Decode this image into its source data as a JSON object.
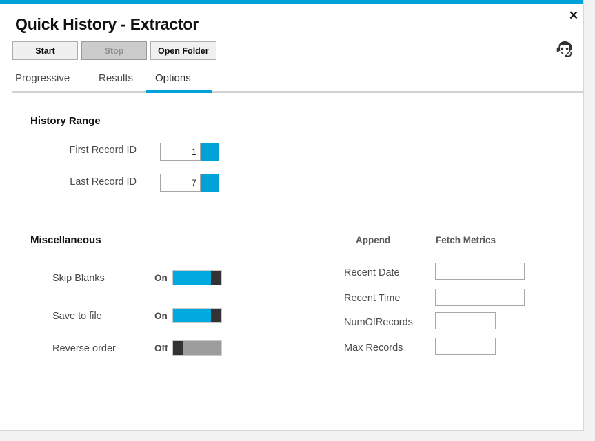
{
  "window": {
    "title": "Quick History - Extractor",
    "close_label": "✕",
    "accent_color": "#00a2d8",
    "avatar_icon": "headset-support-avatar-icon"
  },
  "toolbar": {
    "buttons": [
      {
        "label": "Start",
        "disabled": false
      },
      {
        "label": "Stop",
        "disabled": true
      },
      {
        "label": "Open Folder",
        "disabled": false
      }
    ]
  },
  "tabs": {
    "items": [
      {
        "label": "Progressive",
        "active": false
      },
      {
        "label": "Results",
        "active": false
      },
      {
        "label": "Options",
        "active": true
      }
    ]
  },
  "history_range": {
    "heading": "History Range",
    "fields": [
      {
        "label": "First Record ID",
        "value": "1"
      },
      {
        "label": "Last Record ID",
        "value": "7"
      }
    ]
  },
  "miscellaneous": {
    "heading": "Miscellaneous",
    "toggles": [
      {
        "label": "Skip Blanks",
        "state": "On",
        "on": true
      },
      {
        "label": "Save to file",
        "state": "On",
        "on": true
      },
      {
        "label": "Reverse order",
        "state": "Off",
        "on": false
      }
    ]
  },
  "metrics": {
    "append_header": "Append",
    "fetch_header": "Fetch Metrics",
    "rows": [
      {
        "label": "Recent Date",
        "value": "",
        "placeholder": ""
      },
      {
        "label": "Recent Time",
        "value": "",
        "placeholder": ""
      },
      {
        "label": "NumOfRecords",
        "value": "",
        "placeholder": ""
      },
      {
        "label": "Max Records",
        "value": "",
        "placeholder": ""
      }
    ]
  }
}
